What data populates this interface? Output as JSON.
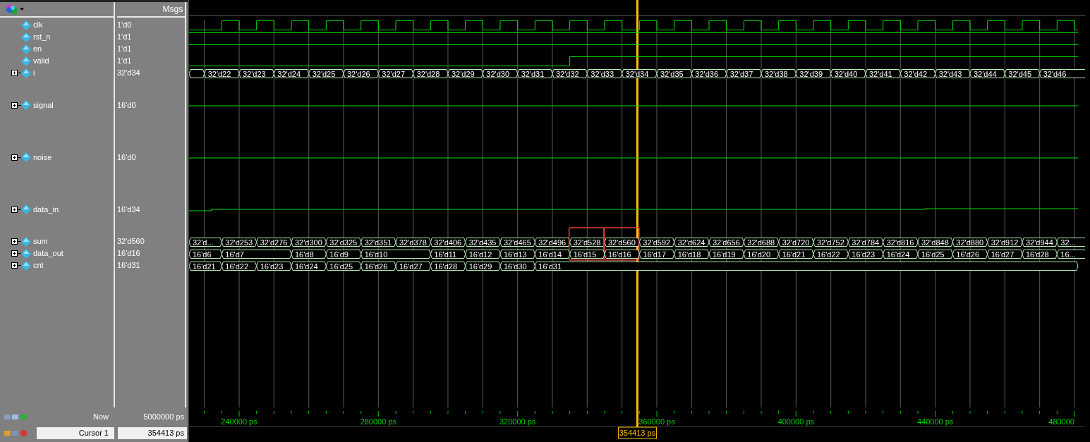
{
  "header": {
    "msgs_label": "Msgs"
  },
  "signals": [
    {
      "name": "clk",
      "value": "1'd0",
      "kind": "clock",
      "expandable": false
    },
    {
      "name": "rst_n",
      "value": "1'd1",
      "kind": "high",
      "expandable": false
    },
    {
      "name": "en",
      "value": "1'd1",
      "kind": "high",
      "expandable": false
    },
    {
      "name": "valid",
      "value": "1'd1",
      "kind": "rising",
      "expandable": false
    },
    {
      "name": "i",
      "value": "32'd34",
      "kind": "bus",
      "expandable": true,
      "stub": true,
      "segments": [
        {
          "label": "32'd22"
        },
        {
          "label": "32'd23"
        },
        {
          "label": "32'd24"
        },
        {
          "label": "32'd25"
        },
        {
          "label": "32'd26"
        },
        {
          "label": "32'd27"
        },
        {
          "label": "32'd28"
        },
        {
          "label": "32'd29"
        },
        {
          "label": "32'd30"
        },
        {
          "label": "32'd31"
        },
        {
          "label": "32'd32"
        },
        {
          "label": "32'd33"
        },
        {
          "label": "32'd34"
        },
        {
          "label": "32'd35"
        },
        {
          "label": "32'd36"
        },
        {
          "label": "32'd37"
        },
        {
          "label": "32'd38"
        },
        {
          "label": "32'd39"
        },
        {
          "label": "32'd40"
        },
        {
          "label": "32'd41"
        },
        {
          "label": "32'd42"
        },
        {
          "label": "32'd43"
        },
        {
          "label": "32'd44"
        },
        {
          "label": "32'd45"
        },
        {
          "label": "32'd46"
        }
      ]
    },
    {
      "name": "signal",
      "value": "16'd0",
      "kind": "analog",
      "expandable": true
    },
    {
      "name": "noise",
      "value": "16'd0",
      "kind": "analog",
      "expandable": true
    },
    {
      "name": "data_in",
      "value": "16'd34",
      "kind": "analog",
      "expandable": true
    },
    {
      "name": "sum",
      "value": "32'd560",
      "kind": "bus",
      "expandable": true,
      "stub": false,
      "segments": [
        {
          "label": "32'd...",
          "boxed": false
        },
        {
          "label": "32'd253",
          "boxed": false
        },
        {
          "label": "32'd276",
          "boxed": false
        },
        {
          "label": "32'd300",
          "boxed": false
        },
        {
          "label": "32'd325",
          "boxed": false
        },
        {
          "label": "32'd351",
          "boxed": false
        },
        {
          "label": "32'd378",
          "boxed": false
        },
        {
          "label": "32'd406",
          "boxed": false
        },
        {
          "label": "32'd435",
          "boxed": false
        },
        {
          "label": "32'd465",
          "boxed": false
        },
        {
          "label": "32'd496",
          "boxed": false
        },
        {
          "label": "32'd528",
          "boxed": true
        },
        {
          "label": "32'd560",
          "boxed": true
        },
        {
          "label": "32'd592",
          "boxed": false
        },
        {
          "label": "32'd624",
          "boxed": false
        },
        {
          "label": "32'd656",
          "boxed": false
        },
        {
          "label": "32'd688",
          "boxed": false
        },
        {
          "label": "32'd720",
          "boxed": false
        },
        {
          "label": "32'd752",
          "boxed": false
        },
        {
          "label": "32'd784",
          "boxed": false
        },
        {
          "label": "32'd816",
          "boxed": false
        },
        {
          "label": "32'd848",
          "boxed": false
        },
        {
          "label": "32'd880",
          "boxed": false
        },
        {
          "label": "32'd912",
          "boxed": false
        },
        {
          "label": "32'd944",
          "boxed": false
        },
        {
          "label": "32...",
          "boxed": false
        }
      ]
    },
    {
      "name": "data_out",
      "value": "16'd16",
      "kind": "bus",
      "expandable": true,
      "stub": false,
      "segments": [
        {
          "label": "16'd6",
          "wide": false
        },
        {
          "label": "16'd7",
          "wide": true
        },
        {
          "label": "16'd8",
          "wide": false
        },
        {
          "label": "16'd9",
          "wide": false
        },
        {
          "label": "16'd10",
          "wide": true
        },
        {
          "label": "16'd11",
          "wide": false
        },
        {
          "label": "16'd12",
          "wide": false
        },
        {
          "label": "16'd13",
          "wide": false
        },
        {
          "label": "16'd14",
          "wide": false
        },
        {
          "label": "16'd15",
          "wide": false
        },
        {
          "label": "16'd16",
          "wide": false
        },
        {
          "label": "16'd17",
          "wide": false
        },
        {
          "label": "16'd18",
          "wide": false
        },
        {
          "label": "16'd19",
          "wide": false
        },
        {
          "label": "16'd20",
          "wide": false
        },
        {
          "label": "16'd21",
          "wide": false
        },
        {
          "label": "16'd22",
          "wide": false
        },
        {
          "label": "16'd23",
          "wide": false
        },
        {
          "label": "16'd24",
          "wide": false
        },
        {
          "label": "16'd25",
          "wide": false
        },
        {
          "label": "16'd26",
          "wide": false
        },
        {
          "label": "16'd27",
          "wide": false
        },
        {
          "label": "16'd28",
          "wide": false
        },
        {
          "label": "16...",
          "wide": false
        }
      ]
    },
    {
      "name": "cnt",
      "value": "16'd31",
      "kind": "bus",
      "expandable": true,
      "stub": false,
      "segments": [
        {
          "label": "16'd21"
        },
        {
          "label": "16'd22"
        },
        {
          "label": "16'd23"
        },
        {
          "label": "16'd24"
        },
        {
          "label": "16'd25"
        },
        {
          "label": "16'd26"
        },
        {
          "label": "16'd27"
        },
        {
          "label": "16'd28"
        },
        {
          "label": "16'd29"
        },
        {
          "label": "16'd30"
        },
        {
          "label": "16'd31"
        }
      ]
    }
  ],
  "now": {
    "label": "Now",
    "time": "5000000 ps"
  },
  "cursor": {
    "label": "Cursor 1",
    "time": "354413 ps",
    "readout": "354413 ps"
  },
  "ruler": {
    "labels": [
      "240000 ps",
      "280000 ps",
      "320000 ps",
      "360000 ps",
      "400000 ps",
      "440000 ps",
      "480000"
    ]
  }
}
